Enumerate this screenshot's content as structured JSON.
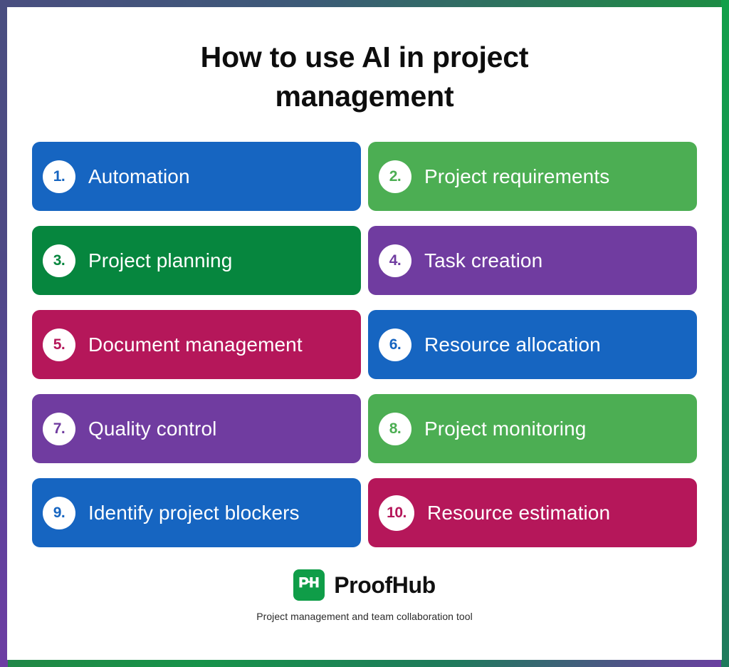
{
  "poster": {
    "title": "How to use AI in project management",
    "border_gradient": {
      "top_left": "#4a4e80",
      "top_right": "#12a04a",
      "bottom_right": "#1f7a5c",
      "bottom_left": "#6d3da3"
    },
    "background": "#ffffff"
  },
  "items": [
    {
      "number": "1.",
      "label": "Automation",
      "color": "#1665c1",
      "number_color": "#1665c1"
    },
    {
      "number": "2.",
      "label": "Project requirements",
      "color": "#4cae53",
      "number_color": "#4cae53"
    },
    {
      "number": "3.",
      "label": "Project planning",
      "color": "#06863e",
      "number_color": "#06863e"
    },
    {
      "number": "4.",
      "label": "Task creation",
      "color": "#703ca0",
      "number_color": "#703ca0"
    },
    {
      "number": "5.",
      "label": "Document management",
      "color": "#b5175a",
      "number_color": "#b5175a"
    },
    {
      "number": "6.",
      "label": "Resource allocation",
      "color": "#1665c1",
      "number_color": "#1665c1"
    },
    {
      "number": "7.",
      "label": "Quality control",
      "color": "#703ca0",
      "number_color": "#703ca0"
    },
    {
      "number": "8.",
      "label": "Project monitoring",
      "color": "#4cae53",
      "number_color": "#4cae53"
    },
    {
      "number": "9.",
      "label": "Identify project blockers",
      "color": "#1665c1",
      "number_color": "#1665c1"
    },
    {
      "number": "10.",
      "label": "Resource estimation",
      "color": "#b5175a",
      "number_color": "#b5175a"
    }
  ],
  "footer": {
    "logo_mark_text": "PH",
    "logo_mark_color": "#0f9d48",
    "brand_name": "ProofHub",
    "tagline": "Project management and team collaboration tool"
  }
}
